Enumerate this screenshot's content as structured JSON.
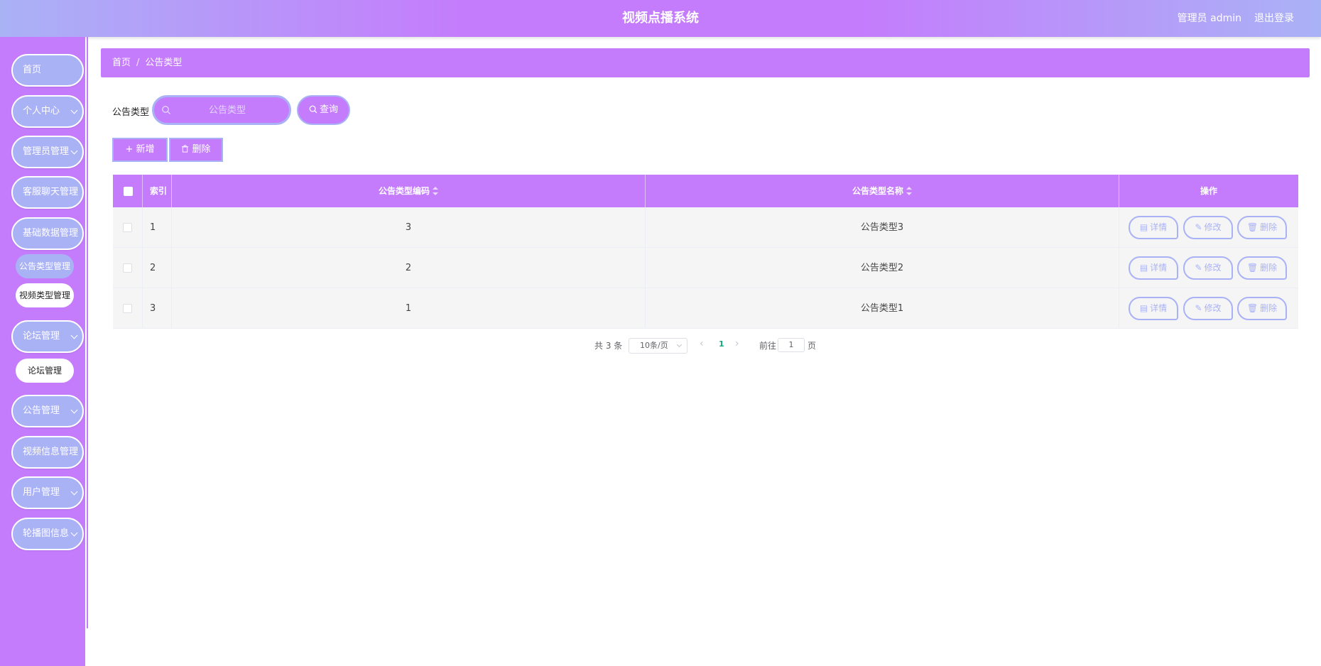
{
  "header": {
    "title": "视频点播系统",
    "user": "管理员 admin",
    "logout": "退出登录"
  },
  "sidebar": {
    "items": [
      {
        "label": "首页"
      },
      {
        "label": "个人中心"
      },
      {
        "label": "管理员管理"
      },
      {
        "label": "客服聊天管理"
      },
      {
        "label": "基础数据管理"
      },
      {
        "label": "论坛管理"
      },
      {
        "label": "公告管理"
      },
      {
        "label": "视频信息管理"
      },
      {
        "label": "用户管理"
      },
      {
        "label": "轮播图信息"
      }
    ],
    "sub_items": {
      "notice_type": "公告类型管理",
      "video_type": "视频类型管理",
      "forum": "论坛管理"
    }
  },
  "breadcrumb": {
    "home": "首页",
    "separator": "/",
    "current": "公告类型"
  },
  "search": {
    "label": "公告类型",
    "placeholder": "公告类型",
    "button": "查询"
  },
  "actions": {
    "add": "新增",
    "delete": "删除"
  },
  "table": {
    "columns": {
      "index": "索引",
      "code": "公告类型编码",
      "name": "公告类型名称",
      "ops": "操作"
    },
    "rows": [
      {
        "index": "1",
        "code": "3",
        "name": "公告类型3"
      },
      {
        "index": "2",
        "code": "2",
        "name": "公告类型2"
      },
      {
        "index": "3",
        "code": "1",
        "name": "公告类型1"
      }
    ],
    "row_buttons": {
      "detail": "详情",
      "edit": "修改",
      "delete": "删除"
    }
  },
  "pagination": {
    "total": "共 3 条",
    "page_size": "10条/页",
    "current_page": "1",
    "goto_label": "前往",
    "goto_value": "1",
    "page_unit": "页"
  },
  "colors": {
    "primary": "#c47cfc",
    "secondary": "#aab2f6"
  }
}
